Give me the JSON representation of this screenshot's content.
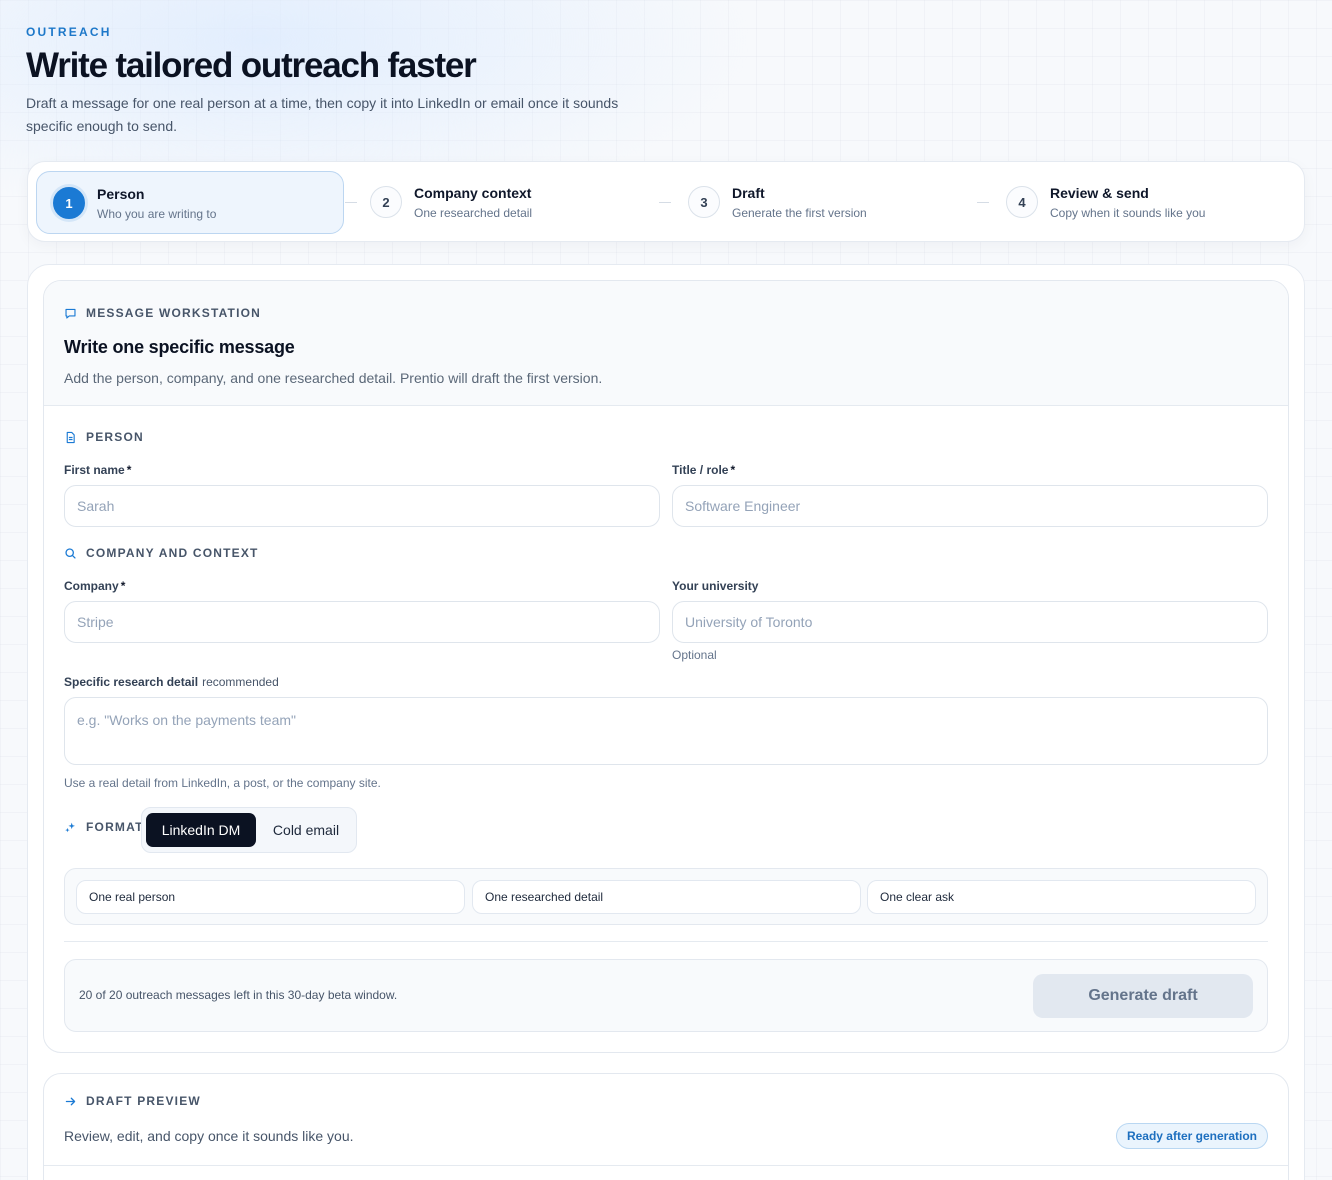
{
  "header": {
    "eyebrow": "OUTREACH",
    "title": "Write tailored outreach faster",
    "subtitle": "Draft a message for one real person at a time, then copy it into LinkedIn or email once it sounds specific enough to send."
  },
  "steps": [
    {
      "number": "1",
      "title": "Person",
      "subtitle": "Who you are writing to",
      "active": true
    },
    {
      "number": "2",
      "title": "Company context",
      "subtitle": "One researched detail",
      "active": false
    },
    {
      "number": "3",
      "title": "Draft",
      "subtitle": "Generate the first version",
      "active": false
    },
    {
      "number": "4",
      "title": "Review & send",
      "subtitle": "Copy when it sounds like you",
      "active": false
    }
  ],
  "workstation": {
    "label": "MESSAGE WORKSTATION",
    "title": "Write one specific message",
    "subtitle": "Add the person, company, and one researched detail. Prentio will draft the first version."
  },
  "person": {
    "label": "PERSON",
    "first_name": {
      "label": "First name",
      "required": "*",
      "value": "",
      "placeholder": "Sarah"
    },
    "title_role": {
      "label": "Title / role",
      "required": "*",
      "value": "",
      "placeholder": "Software Engineer"
    }
  },
  "company": {
    "label": "COMPANY AND CONTEXT",
    "company": {
      "label": "Company",
      "required": "*",
      "value": "",
      "placeholder": "Stripe"
    },
    "university": {
      "label": "Your university",
      "value": "",
      "placeholder": "University of Toronto",
      "helper": "Optional"
    },
    "research": {
      "label": "Specific research detail",
      "hint": "recommended",
      "value": "",
      "placeholder": "e.g. \"Works on the payments team\"",
      "helper": "Use a real detail from LinkedIn, a post, or the company site."
    }
  },
  "format": {
    "label": "FORMAT",
    "options": [
      "LinkedIn DM",
      "Cold email"
    ],
    "selected": "LinkedIn DM"
  },
  "checklist": [
    "One real person",
    "One researched detail",
    "One clear ask"
  ],
  "generate": {
    "quota": "20 of 20 outreach messages left in this 30-day beta window.",
    "button": "Generate draft"
  },
  "preview": {
    "label": "DRAFT PREVIEW",
    "subtitle": "Review, edit, and copy once it sounds like you.",
    "badge": "Ready after generation"
  },
  "colors": {
    "accent": "#1b7ad4",
    "ink": "#0b1222",
    "muted": "#64748b"
  }
}
